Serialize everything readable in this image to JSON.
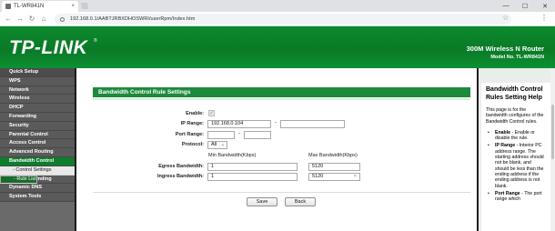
{
  "browser": {
    "tab_title": "TL-WR841N",
    "tab_close": "×",
    "new_tab": "+",
    "win_min": "—",
    "win_max": "☐",
    "win_close": "✕",
    "back": "←",
    "forward": "→",
    "reload": "↻",
    "home": "⌂",
    "url": "192.168.0.1/AABTJRBXDHOSWRI/userRpm/Index.htm",
    "star": "☆",
    "menu": "⋮"
  },
  "header": {
    "logo": "TP-LINK",
    "logo_reg": "®",
    "product": "300M Wireless N Router",
    "model": "Model No. TL-WR841N"
  },
  "menu": [
    {
      "label": "Quick Setup",
      "kind": "first"
    },
    {
      "label": "WPS",
      "kind": ""
    },
    {
      "label": "Network",
      "kind": ""
    },
    {
      "label": "Wireless",
      "kind": ""
    },
    {
      "label": "DHCP",
      "kind": ""
    },
    {
      "label": "Forwarding",
      "kind": ""
    },
    {
      "label": "Security",
      "kind": ""
    },
    {
      "label": "Parental Control",
      "kind": ""
    },
    {
      "label": "Access Control",
      "kind": ""
    },
    {
      "label": "Advanced Routing",
      "kind": ""
    },
    {
      "label": "Bandwidth Control",
      "kind": "active"
    },
    {
      "label": "- Control Settings",
      "kind": "sub"
    },
    {
      "label": "- Rule List",
      "kind": "sub sel"
    },
    {
      "label": "IP & MAC Binding",
      "kind": ""
    },
    {
      "label": "Dynamic DNS",
      "kind": ""
    },
    {
      "label": "System Tools",
      "kind": ""
    }
  ],
  "form": {
    "section_title": "Bandwidth Control Rule Settings",
    "enable_label": "Enable:",
    "enable_checked": true,
    "check_mark": "✓",
    "ip_range_label": "IP Range:",
    "ip_start": "192.168.0.104",
    "ip_end": "",
    "port_range_label": "Port Range:",
    "port_start": "",
    "port_end": "",
    "dash": "-",
    "protocol_label": "Protocol:",
    "protocol_value": "All",
    "select_arrow": "⌄",
    "min_bw_header": "Min Bandwidth(Kbps)",
    "max_bw_header": "Max Bandwidth(Kbps)",
    "egress_label": "Egress Bandwidth:",
    "egress_min": "1",
    "egress_max": "5120",
    "ingress_label": "Ingress Bandwidth:",
    "ingress_min": "1",
    "ingress_max": "5120",
    "clear_glyph": "×",
    "save": "Save",
    "back": "Back"
  },
  "help": {
    "title": "Bandwidth Control Rules Setting Help",
    "intro": "This page is for the bandwidth configures of the Bandwidth Control rules.",
    "bullet": "•",
    "items": [
      {
        "key": "Enable",
        "text": " - Enable or disable the rule."
      },
      {
        "key": "IP Range",
        "text": " - Interior PC address range. The starting address should not be blank, and should be less than the ending address if the ending address is not blank."
      },
      {
        "key": "Port Range",
        "text": " - The port range which"
      }
    ]
  },
  "colors": {
    "brand_green": "#0c8a2e",
    "section_green": "#1e8a3b",
    "menu_gray": "#5a5a5a"
  }
}
